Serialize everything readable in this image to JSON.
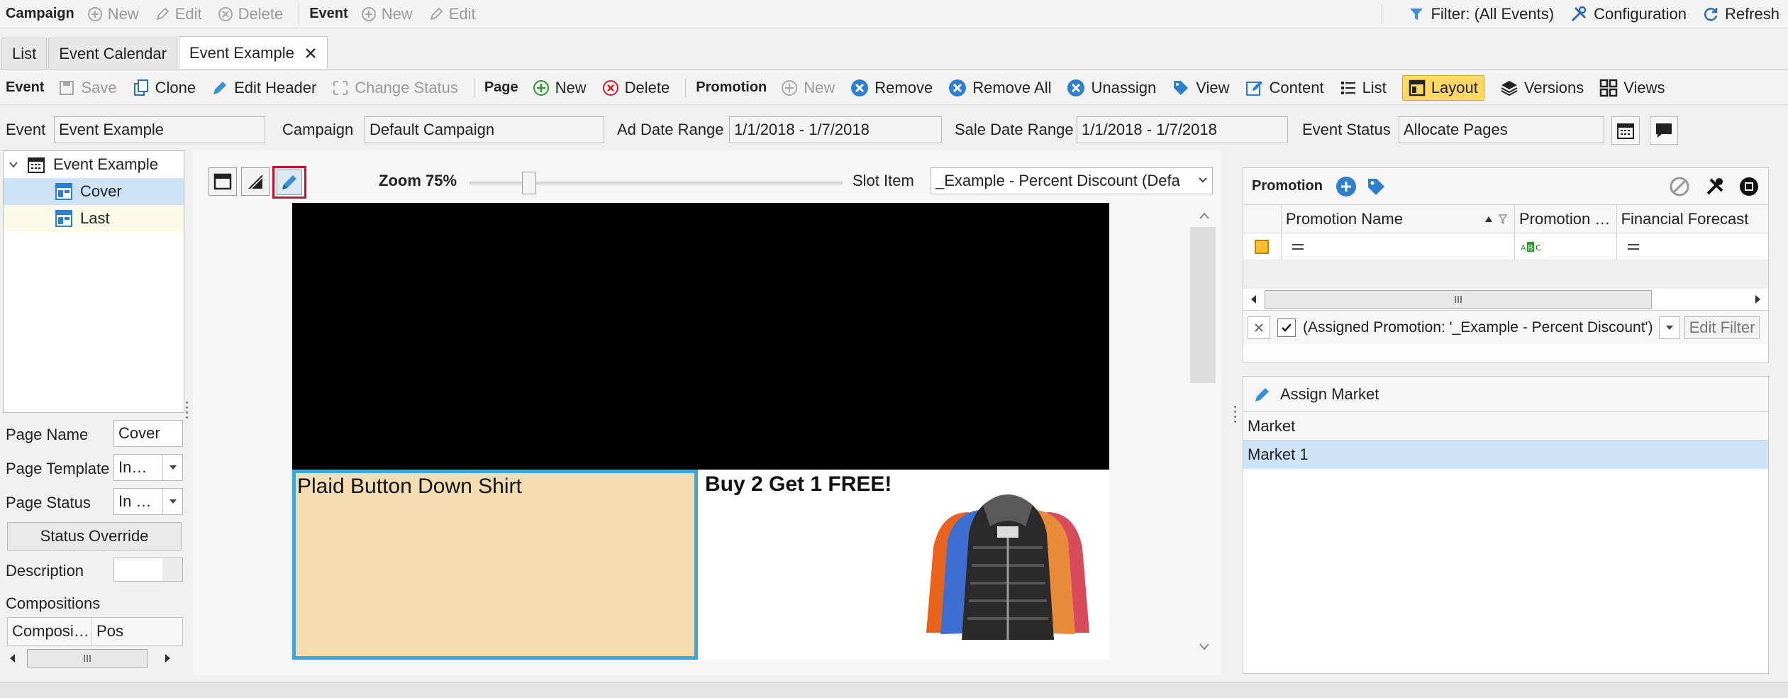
{
  "topbar": {
    "campaign_label": "Campaign",
    "campaign_new": "New",
    "campaign_edit": "Edit",
    "campaign_delete": "Delete",
    "event_label": "Event",
    "event_new": "New",
    "event_edit": "Edit",
    "filter": "Filter: (All Events)",
    "configuration": "Configuration",
    "refresh": "Refresh"
  },
  "tabs": [
    {
      "label": "List"
    },
    {
      "label": "Event Calendar"
    },
    {
      "label": "Event Example"
    }
  ],
  "toolbar": {
    "event_label": "Event",
    "save": "Save",
    "clone": "Clone",
    "edit_header": "Edit Header",
    "change_status": "Change Status",
    "page_label": "Page",
    "page_new": "New",
    "page_delete": "Delete",
    "promotion_label": "Promotion",
    "promo_new": "New",
    "remove": "Remove",
    "remove_all": "Remove All",
    "unassign": "Unassign",
    "view": "View",
    "content": "Content",
    "list": "List",
    "layout": "Layout",
    "versions": "Versions",
    "views": "Views"
  },
  "fields": {
    "event_label": "Event",
    "event_value": "Event Example",
    "campaign_label": "Campaign",
    "campaign_value": "Default Campaign",
    "ad_date_label": "Ad Date Range",
    "ad_date_value": "1/1/2018 - 1/7/2018",
    "sale_date_label": "Sale Date Range",
    "sale_date_value": "1/1/2018 - 1/7/2018",
    "status_label": "Event Status",
    "status_value": "Allocate Pages"
  },
  "tree": {
    "root": "Event Example",
    "children": [
      {
        "label": "Cover"
      },
      {
        "label": "Last"
      }
    ]
  },
  "page_props": {
    "page_name_label": "Page Name",
    "page_name_value": "Cover",
    "page_template_label": "Page Template",
    "page_template_value": "In…",
    "page_status_label": "Page Status",
    "page_status_value": "In …",
    "status_override": "Status Override",
    "description_label": "Description",
    "compositions_label": "Compositions",
    "comp_col1": "Composi…",
    "comp_col2": "Pos"
  },
  "canvas_toolbar": {
    "zoom_label": "Zoom 75%",
    "slot_item_label": "Slot Item",
    "slot_item_value": "_Example - Percent Discount (Defa"
  },
  "canvas": {
    "slot1_text": "Plaid Button Down Shirt",
    "slot2_text": "Buy 2 Get 1 FREE!"
  },
  "promotion_panel": {
    "title": "Promotion",
    "columns": [
      "Promotion Name",
      "Promotion …",
      "Financial Forecast"
    ],
    "filter_text": "(Assigned Promotion: '_Example - Percent Discount')",
    "edit_filter": "Edit Filter"
  },
  "market_panel": {
    "title": "Assign Market",
    "column": "Market",
    "rows": [
      {
        "label": "Market 1"
      }
    ]
  },
  "colors": {
    "accent_selected": "#cfe3f7",
    "layout_active": "#ffd866",
    "slot_highlight": "#3aa8e0",
    "slot_fill": "#f5dcb1",
    "highlight_border": "#c8102e"
  }
}
